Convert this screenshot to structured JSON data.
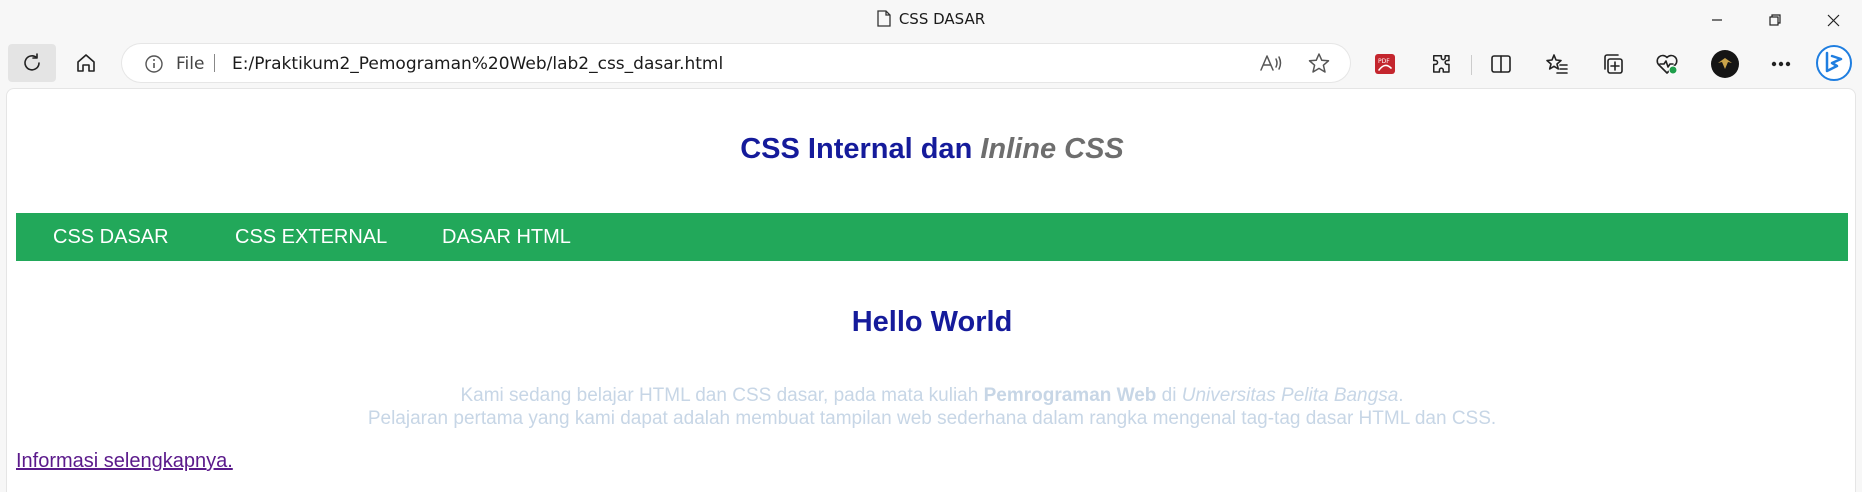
{
  "window": {
    "title": "CSS DASAR"
  },
  "toolbar": {
    "address_prefix": "File",
    "url": "E:/Praktikum2_Pemograman%20Web/lab2_css_dasar.html",
    "icons": [
      "reload-icon",
      "home-icon",
      "info-icon",
      "read-aloud-icon",
      "favorite-star-icon",
      "pdf-extension-icon",
      "extensions-icon",
      "split-screen-icon",
      "favorites-icon",
      "collections-icon",
      "browser-essentials-icon",
      "profile-avatar",
      "more-icon",
      "copilot-icon"
    ]
  },
  "page": {
    "heading": {
      "part1": "CSS Internal dan ",
      "part2_italic": "Inline CSS"
    },
    "nav": [
      "CSS DASAR",
      "CSS EXTERNAL",
      "DASAR HTML"
    ],
    "hello": "Hello World",
    "para_line1": {
      "a": "Kami sedang belajar HTML dan CSS dasar, pada mata kuliah ",
      "b": "Pemrograman Web",
      "c": " di ",
      "d": "Universitas Pelita Bangsa",
      "e": "."
    },
    "para_line2": "Pelajaran pertama yang kami dapat adalah membuat tampilan web sederhana dalam rangka mengenal tag-tag dasar HTML dan CSS.",
    "more_link": "Informasi selengkapnya."
  },
  "colors": {
    "nav_bg": "#22a85a",
    "heading": "#151b9b",
    "inline_css": "#6e6e6e",
    "paragraph": "#c7d6e6",
    "link_visited": "#5b1a8b"
  }
}
